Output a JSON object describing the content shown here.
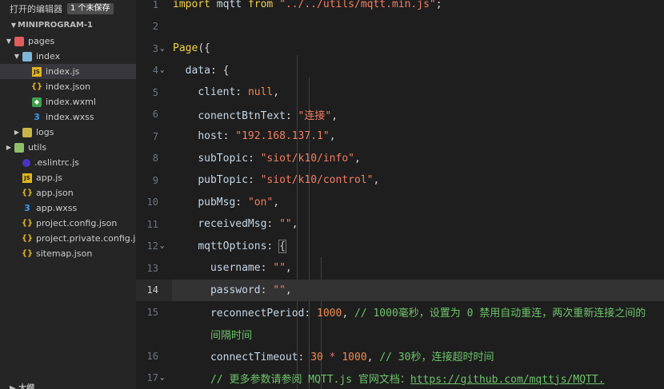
{
  "sidebar": {
    "open_editors_title": "打开的编辑器",
    "unsaved_badge": "1 个未保存",
    "project_name": "MINIPROGRAM-1",
    "outline_label": "大纲",
    "items": [
      {
        "label": "pages",
        "icon": "folder-open-icon"
      },
      {
        "label": "index",
        "icon": "folder-open-icon"
      },
      {
        "label": "index.js",
        "icon": "js-file-icon"
      },
      {
        "label": "index.json",
        "icon": "json-file-icon"
      },
      {
        "label": "index.wxml",
        "icon": "wxml-file-icon"
      },
      {
        "label": "index.wxss",
        "icon": "wxss-file-icon"
      },
      {
        "label": "logs",
        "icon": "folder-icon"
      },
      {
        "label": "utils",
        "icon": "folder-icon"
      },
      {
        "label": ".eslintrc.js",
        "icon": "eslint-icon"
      },
      {
        "label": "app.js",
        "icon": "js-file-icon"
      },
      {
        "label": "app.json",
        "icon": "json-file-icon"
      },
      {
        "label": "app.wxss",
        "icon": "wxss-file-icon"
      },
      {
        "label": "project.config.json",
        "icon": "json-file-icon"
      },
      {
        "label": "project.private.config.js...",
        "icon": "json-file-icon"
      },
      {
        "label": "sitemap.json",
        "icon": "json-file-icon"
      }
    ]
  },
  "editor": {
    "current_line": "14",
    "line_numbers": [
      "1",
      "2",
      "3",
      "4",
      "5",
      "6",
      "7",
      "8",
      "9",
      "10",
      "11",
      "12",
      "13",
      "14",
      "15",
      "",
      "16",
      "17"
    ],
    "code": {
      "l1_kw": "import",
      "l1_id": " mqtt ",
      "l1_from": "from",
      "l1_str": " \"../../utils/mqtt.min.js\"",
      "l1_end": ";",
      "l3_page": "Page",
      "l3_open": "({",
      "l4_key": "data",
      "l4_rest": ": {",
      "l5_key": "client",
      "l5_colon": ": ",
      "l5_val": "null",
      "l5_end": ",",
      "l6_key": "conenctBtnText",
      "l6_colon": ": ",
      "l6_val": "\"连接\"",
      "l6_end": ",",
      "l7_key": "host",
      "l7_colon": ": ",
      "l7_val": "\"192.168.137.1\"",
      "l7_end": ",",
      "l8_key": "subTopic",
      "l8_colon": ": ",
      "l8_val": "\"siot/k10/info\"",
      "l8_end": ",",
      "l9_key": "pubTopic",
      "l9_colon": ": ",
      "l9_val": "\"siot/k10/control\"",
      "l9_end": ",",
      "l10_key": "pubMsg",
      "l10_colon": ": ",
      "l10_val": "\"on\"",
      "l10_end": ",",
      "l11_key": "receivedMsg",
      "l11_colon": ": ",
      "l11_val": "\"\"",
      "l11_end": ",",
      "l12_key": "mqttOptions",
      "l12_colon": ": ",
      "l12_brace": "{",
      "l13_key": "username",
      "l13_colon": ": ",
      "l13_val": "\"\"",
      "l13_end": ",",
      "l14_key": "password",
      "l14_colon": ": ",
      "l14_val": "\"\"",
      "l14_end": ",",
      "l15_key": "reconnectPeriod",
      "l15_colon": ": ",
      "l15_val": "1000",
      "l15_end": ", ",
      "l15_cmt": "// 1000毫秒，设置为 0 禁用自动重连，两次重新连接之间的",
      "l15b_cmt": "间隔时间",
      "l16_key": "connectTimeout",
      "l16_colon": ": ",
      "l16_a": "30",
      "l16_op": " * ",
      "l16_b": "1000",
      "l16_end": ", ",
      "l16_cmt": "// 30秒，连接超时时间",
      "l17_cmt": "// 更多参数请参阅 MQTT.js 官网文档：",
      "l17_url": "https://github.com/mqttjs/MQTT."
    }
  },
  "colors": {
    "background": "#1e1e1e",
    "sidebar": "#252526",
    "keyword": "#f0d34a",
    "string": "#f37f64",
    "comment": "#6ec46a"
  }
}
